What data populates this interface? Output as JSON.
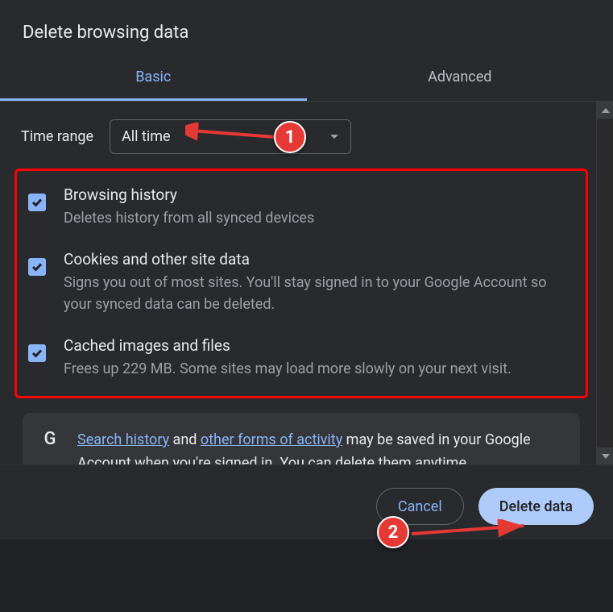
{
  "title": "Delete browsing data",
  "tabs": {
    "basic": "Basic",
    "advanced": "Advanced"
  },
  "time": {
    "label": "Time range",
    "value": "All time"
  },
  "items": [
    {
      "title": "Browsing history",
      "desc": "Deletes history from all synced devices"
    },
    {
      "title": "Cookies and other site data",
      "desc": "Signs you out of most sites. You'll stay signed in to your Google Account so your synced data can be deleted."
    },
    {
      "title": "Cached images and files",
      "desc": "Frees up 229 MB. Some sites may load more slowly on your next visit."
    }
  ],
  "note": {
    "link1": "Search history",
    "mid1": " and ",
    "link2": "other forms of activity",
    "rest": " may be saved in your Google Account when you're signed in. You can delete them anytime."
  },
  "buttons": {
    "cancel": "Cancel",
    "delete": "Delete data"
  },
  "annotations": {
    "b1": "1",
    "b2": "2"
  }
}
